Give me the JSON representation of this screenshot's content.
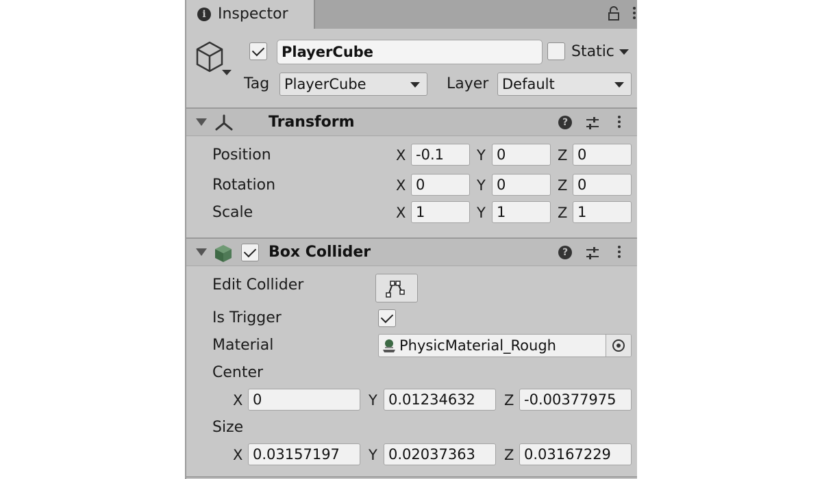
{
  "tab": {
    "title": "Inspector"
  },
  "object": {
    "active": true,
    "name": "PlayerCube",
    "static_label": "Static",
    "static_checked": false,
    "tag_label": "Tag",
    "tag_value": "PlayerCube",
    "layer_label": "Layer",
    "layer_value": "Default"
  },
  "transform": {
    "title": "Transform",
    "rows": [
      {
        "label": "Position",
        "x": "-0.1",
        "y": "0",
        "z": "0"
      },
      {
        "label": "Rotation",
        "x": "0",
        "y": "0",
        "z": "0"
      },
      {
        "label": "Scale",
        "x": "1",
        "y": "1",
        "z": "1"
      }
    ]
  },
  "box_collider": {
    "title": "Box Collider",
    "enabled": true,
    "edit_collider_label": "Edit Collider",
    "is_trigger_label": "Is Trigger",
    "is_trigger": true,
    "material_label": "Material",
    "material_value": "PhysicMaterial_Rough",
    "center_label": "Center",
    "center": {
      "x": "0",
      "y": "0.01234632",
      "z": "-0.00377975"
    },
    "size_label": "Size",
    "size": {
      "x": "0.03157197",
      "y": "0.02037363",
      "z": "0.03167229"
    }
  },
  "axes": {
    "x": "X",
    "y": "Y",
    "z": "Z"
  },
  "icons": {
    "tab": "info-icon",
    "object": "cube-outline-icon",
    "lock": "lock-icon",
    "transform": "transform-axes-icon",
    "collider": "cube-solid-icon",
    "help": "help-icon",
    "preset": "sliders-icon",
    "menu": "kebab-menu-icon",
    "edit_collider": "edit-collider-icon",
    "material": "physic-material-icon",
    "picker": "object-picker-icon"
  },
  "colors": {
    "panel": "#c8c8c8",
    "header": "#bdbdbd",
    "collider_icon": "#4f7a56"
  }
}
